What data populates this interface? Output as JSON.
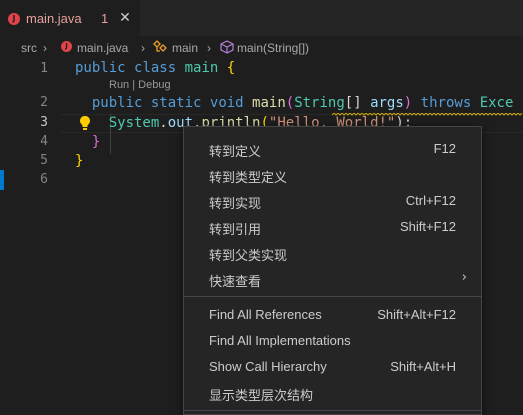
{
  "tab": {
    "icon_letter": "J",
    "filename": "main.java",
    "problem_count": "1",
    "close_glyph": "✕"
  },
  "breadcrumb": {
    "folder": "src",
    "sep": "›",
    "file": "main.java",
    "class_name": "main",
    "method": "main(String[])"
  },
  "gutter": {
    "line_numbers": [
      "1",
      "",
      "2",
      "3",
      "4",
      "5",
      "6"
    ]
  },
  "code": {
    "l1": {
      "kw1": "public",
      "kw2": "class",
      "name": "main",
      "brace": "{"
    },
    "lens": "Run | Debug",
    "l2": {
      "kw1": "public",
      "kw2": "static",
      "kw3": "void",
      "fn": "main",
      "p1": "(",
      "type": "String",
      "p2": "[]",
      "arg": "args",
      "p3": ")",
      "throws": "throws",
      "rest": "Exce"
    },
    "l3": {
      "cls": "System",
      "dot1": ".",
      "field": "out",
      "dot2": ".",
      "fn": "println",
      "p1": "(",
      "str": "\"Hello, World!\"",
      "p2": ");"
    },
    "l4": {
      "brace": "}"
    },
    "l5": {
      "brace": "}"
    }
  },
  "context_menu": {
    "items": [
      {
        "label": "转到定义",
        "shortcut": "F12"
      },
      {
        "label": "转到类型定义",
        "shortcut": ""
      },
      {
        "label": "转到实现",
        "shortcut": "Ctrl+F12"
      },
      {
        "label": "转到引用",
        "shortcut": "Shift+F12"
      },
      {
        "label": "转到父类实现",
        "shortcut": ""
      },
      {
        "label": "快速查看",
        "shortcut": "",
        "submenu_arrow": "›"
      },
      {
        "label": "Find All References",
        "shortcut": "Shift+Alt+F12"
      },
      {
        "label": "Find All Implementations",
        "shortcut": ""
      },
      {
        "label": "Show Call Hierarchy",
        "shortcut": "Shift+Alt+H"
      },
      {
        "label": "显示类型层次结构",
        "shortcut": ""
      }
    ]
  },
  "colors": {
    "keyword": "#569cd6",
    "class": "#4ec9b0",
    "function": "#dcdcaa",
    "string": "#ce9178",
    "error_tab": "#e5a19b"
  },
  "icons": {
    "java_file": "java-file-icon",
    "close": "close-icon",
    "class": "class-icon",
    "method": "method-icon",
    "lightbulb": "lightbulb-icon",
    "submenu": "chevron-right-icon"
  }
}
